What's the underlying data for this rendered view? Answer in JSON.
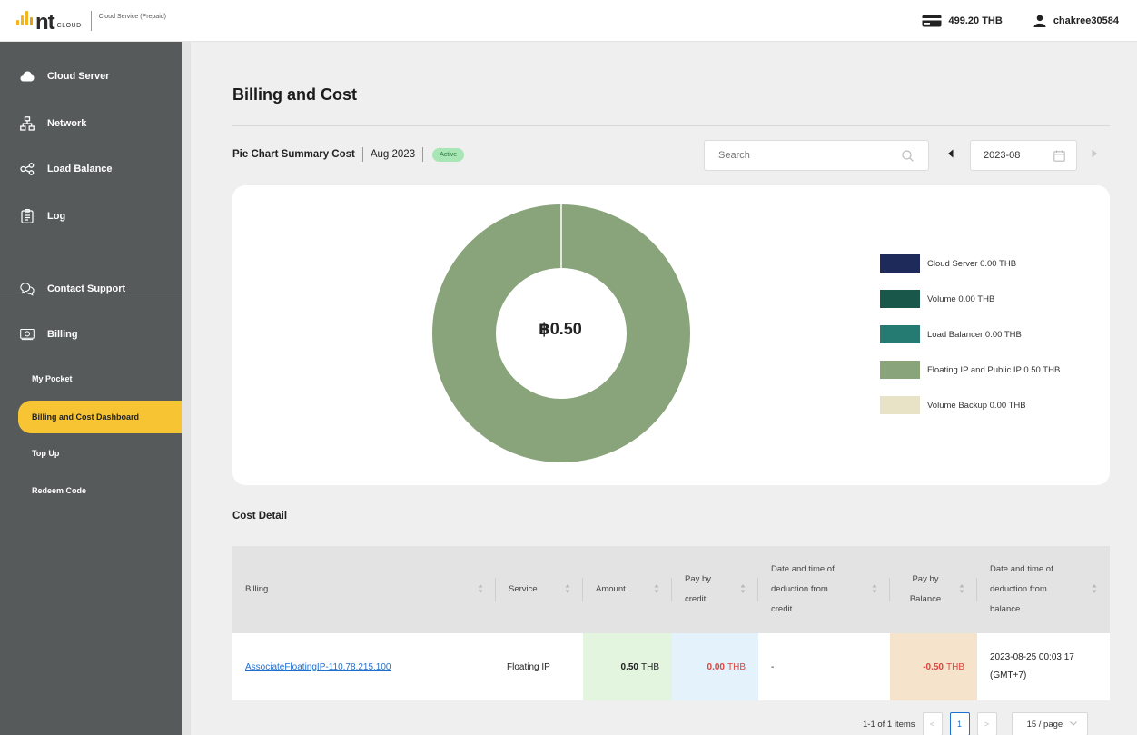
{
  "header": {
    "logo_text": "nt",
    "logo_sub": "CLOUD",
    "service_label": "Cloud Service (Prepaid)",
    "balance": "499.20 THB",
    "username": "chakree30584"
  },
  "sidebar": {
    "items": [
      {
        "label": "Cloud Server",
        "icon": "cloud-icon"
      },
      {
        "label": "Network",
        "icon": "network-icon"
      },
      {
        "label": "Load Balance",
        "icon": "share-icon"
      },
      {
        "label": "Log",
        "icon": "clipboard-icon"
      },
      {
        "label": "Contact Support",
        "icon": "chat-icon"
      },
      {
        "label": "Billing",
        "icon": "money-icon"
      }
    ],
    "billing_sub": [
      {
        "label": "My Pocket",
        "active": false
      },
      {
        "label": "Billing and Cost Dashboard",
        "active": true
      },
      {
        "label": "Top Up",
        "active": false
      },
      {
        "label": "Redeem Code",
        "active": false
      }
    ]
  },
  "main": {
    "title": "Billing and Cost",
    "summary_label": "Pie Chart Summary Cost",
    "summary_period": "Aug 2023",
    "summary_status": "Active",
    "search_placeholder": "Search",
    "month_value": "2023-08",
    "cost_detail_title": "Cost Detail"
  },
  "chart_data": {
    "type": "pie",
    "center_label": "฿0.50",
    "categories": [
      "Cloud Server 0.00 THB",
      "Volume 0.00 THB",
      "Load Balancer 0.00 THB",
      "Floating IP and Public IP 0.50 THB",
      "Volume Backup 0.00 THB"
    ],
    "values": [
      0.0,
      0.0,
      0.0,
      0.5,
      0.0
    ],
    "colors": [
      "#1e2b5a",
      "#19574a",
      "#257a72",
      "#89a37a",
      "#e8e2c7"
    ],
    "donut": true
  },
  "table": {
    "headers": {
      "billing": "Billing",
      "service": "Service",
      "amount": "Amount",
      "pay_credit_1": "Pay by",
      "pay_credit_2": "credit",
      "date_credit_1": "Date and time of",
      "date_credit_2": "deduction from",
      "date_credit_3": "credit",
      "pay_balance_1": "Pay by",
      "pay_balance_2": "Balance",
      "date_balance_1": "Date and time of",
      "date_balance_2": "deduction from",
      "date_balance_3": "balance"
    },
    "rows": [
      {
        "billing": "AssociateFloatingIP-110.78.215.100",
        "service": "Floating IP",
        "amount_value": "0.50",
        "amount_unit": "THB",
        "credit_value": "0.00",
        "credit_unit": "THB",
        "credit_date": "-",
        "balance_value": "-0.50",
        "balance_unit": "THB",
        "balance_date_1": "2023-08-25 00:03:17",
        "balance_date_2": "(GMT+7)"
      }
    ],
    "colors": {
      "amount_bg": "#e3f5df",
      "credit_bg": "#e3f2fb",
      "balance_bg": "#f6e3cc",
      "negative_text": "#d9463e",
      "link": "#1f6fcf"
    }
  },
  "pagination": {
    "summary": "1-1 of 1 items",
    "prev": "<",
    "current_page": "1",
    "next": ">",
    "page_size": "15 / page"
  }
}
